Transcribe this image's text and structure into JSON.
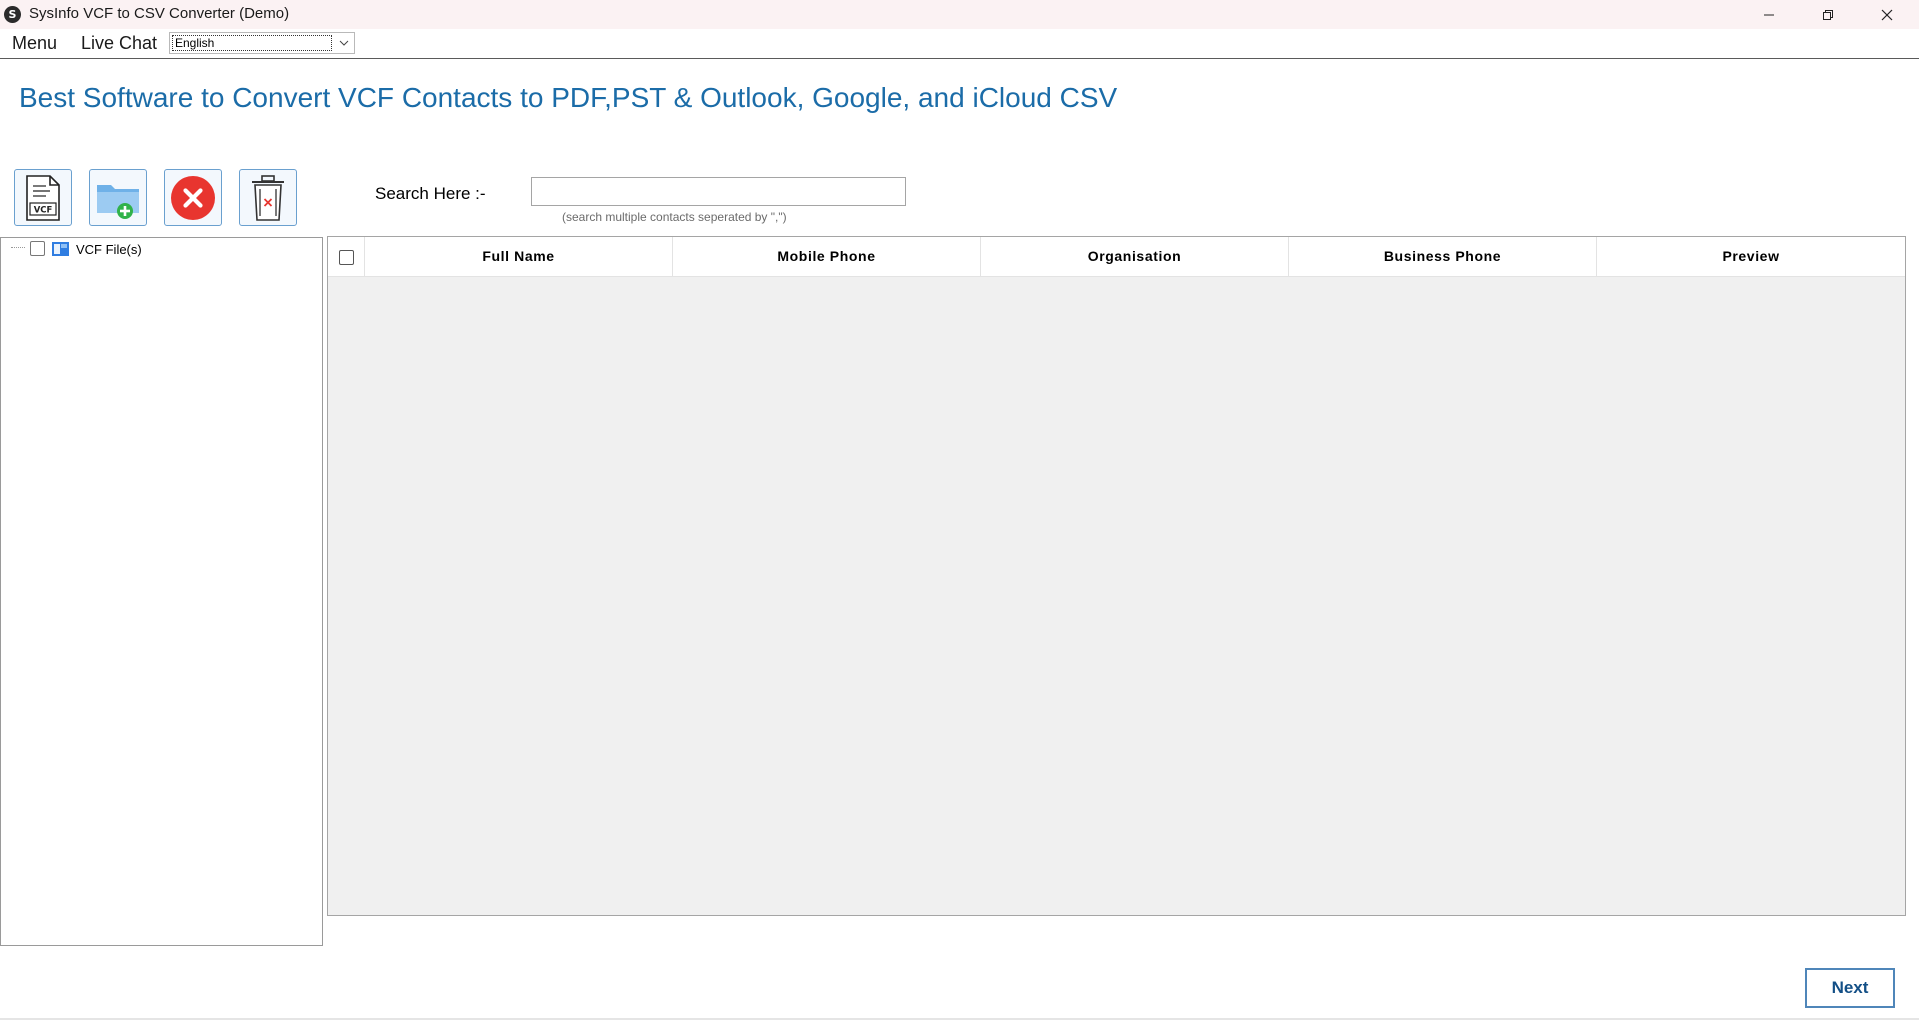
{
  "window": {
    "title": "SysInfo VCF to CSV Converter (Demo)"
  },
  "menubar": {
    "items": [
      {
        "label": "Menu"
      },
      {
        "label": "Live Chat"
      }
    ],
    "language": {
      "selected": "English"
    }
  },
  "heading": "Best Software to Convert VCF Contacts to PDF,PST & Outlook, Google, and iCloud CSV",
  "toolbar": {
    "buttons": [
      {
        "icon": "vcf-file-icon",
        "text": "VCF"
      },
      {
        "icon": "add-folder-icon"
      },
      {
        "icon": "remove-icon"
      },
      {
        "icon": "delete-icon"
      }
    ]
  },
  "search": {
    "label": "Search Here :-",
    "value": "",
    "placeholder": "",
    "hint": "(search multiple contacts seperated by \",\")"
  },
  "tree": {
    "root_label": "VCF File(s)",
    "checked": false
  },
  "grid": {
    "columns": [
      "Full Name",
      "Mobile Phone",
      "Organisation",
      "Business Phone",
      "Preview"
    ],
    "rows": []
  },
  "footer": {
    "next_label": "Next"
  },
  "colors": {
    "heading": "#1b6ca8",
    "accent": "#4f86b9",
    "remove_red": "#e8352f",
    "grid_bg": "#f0f0f0"
  }
}
